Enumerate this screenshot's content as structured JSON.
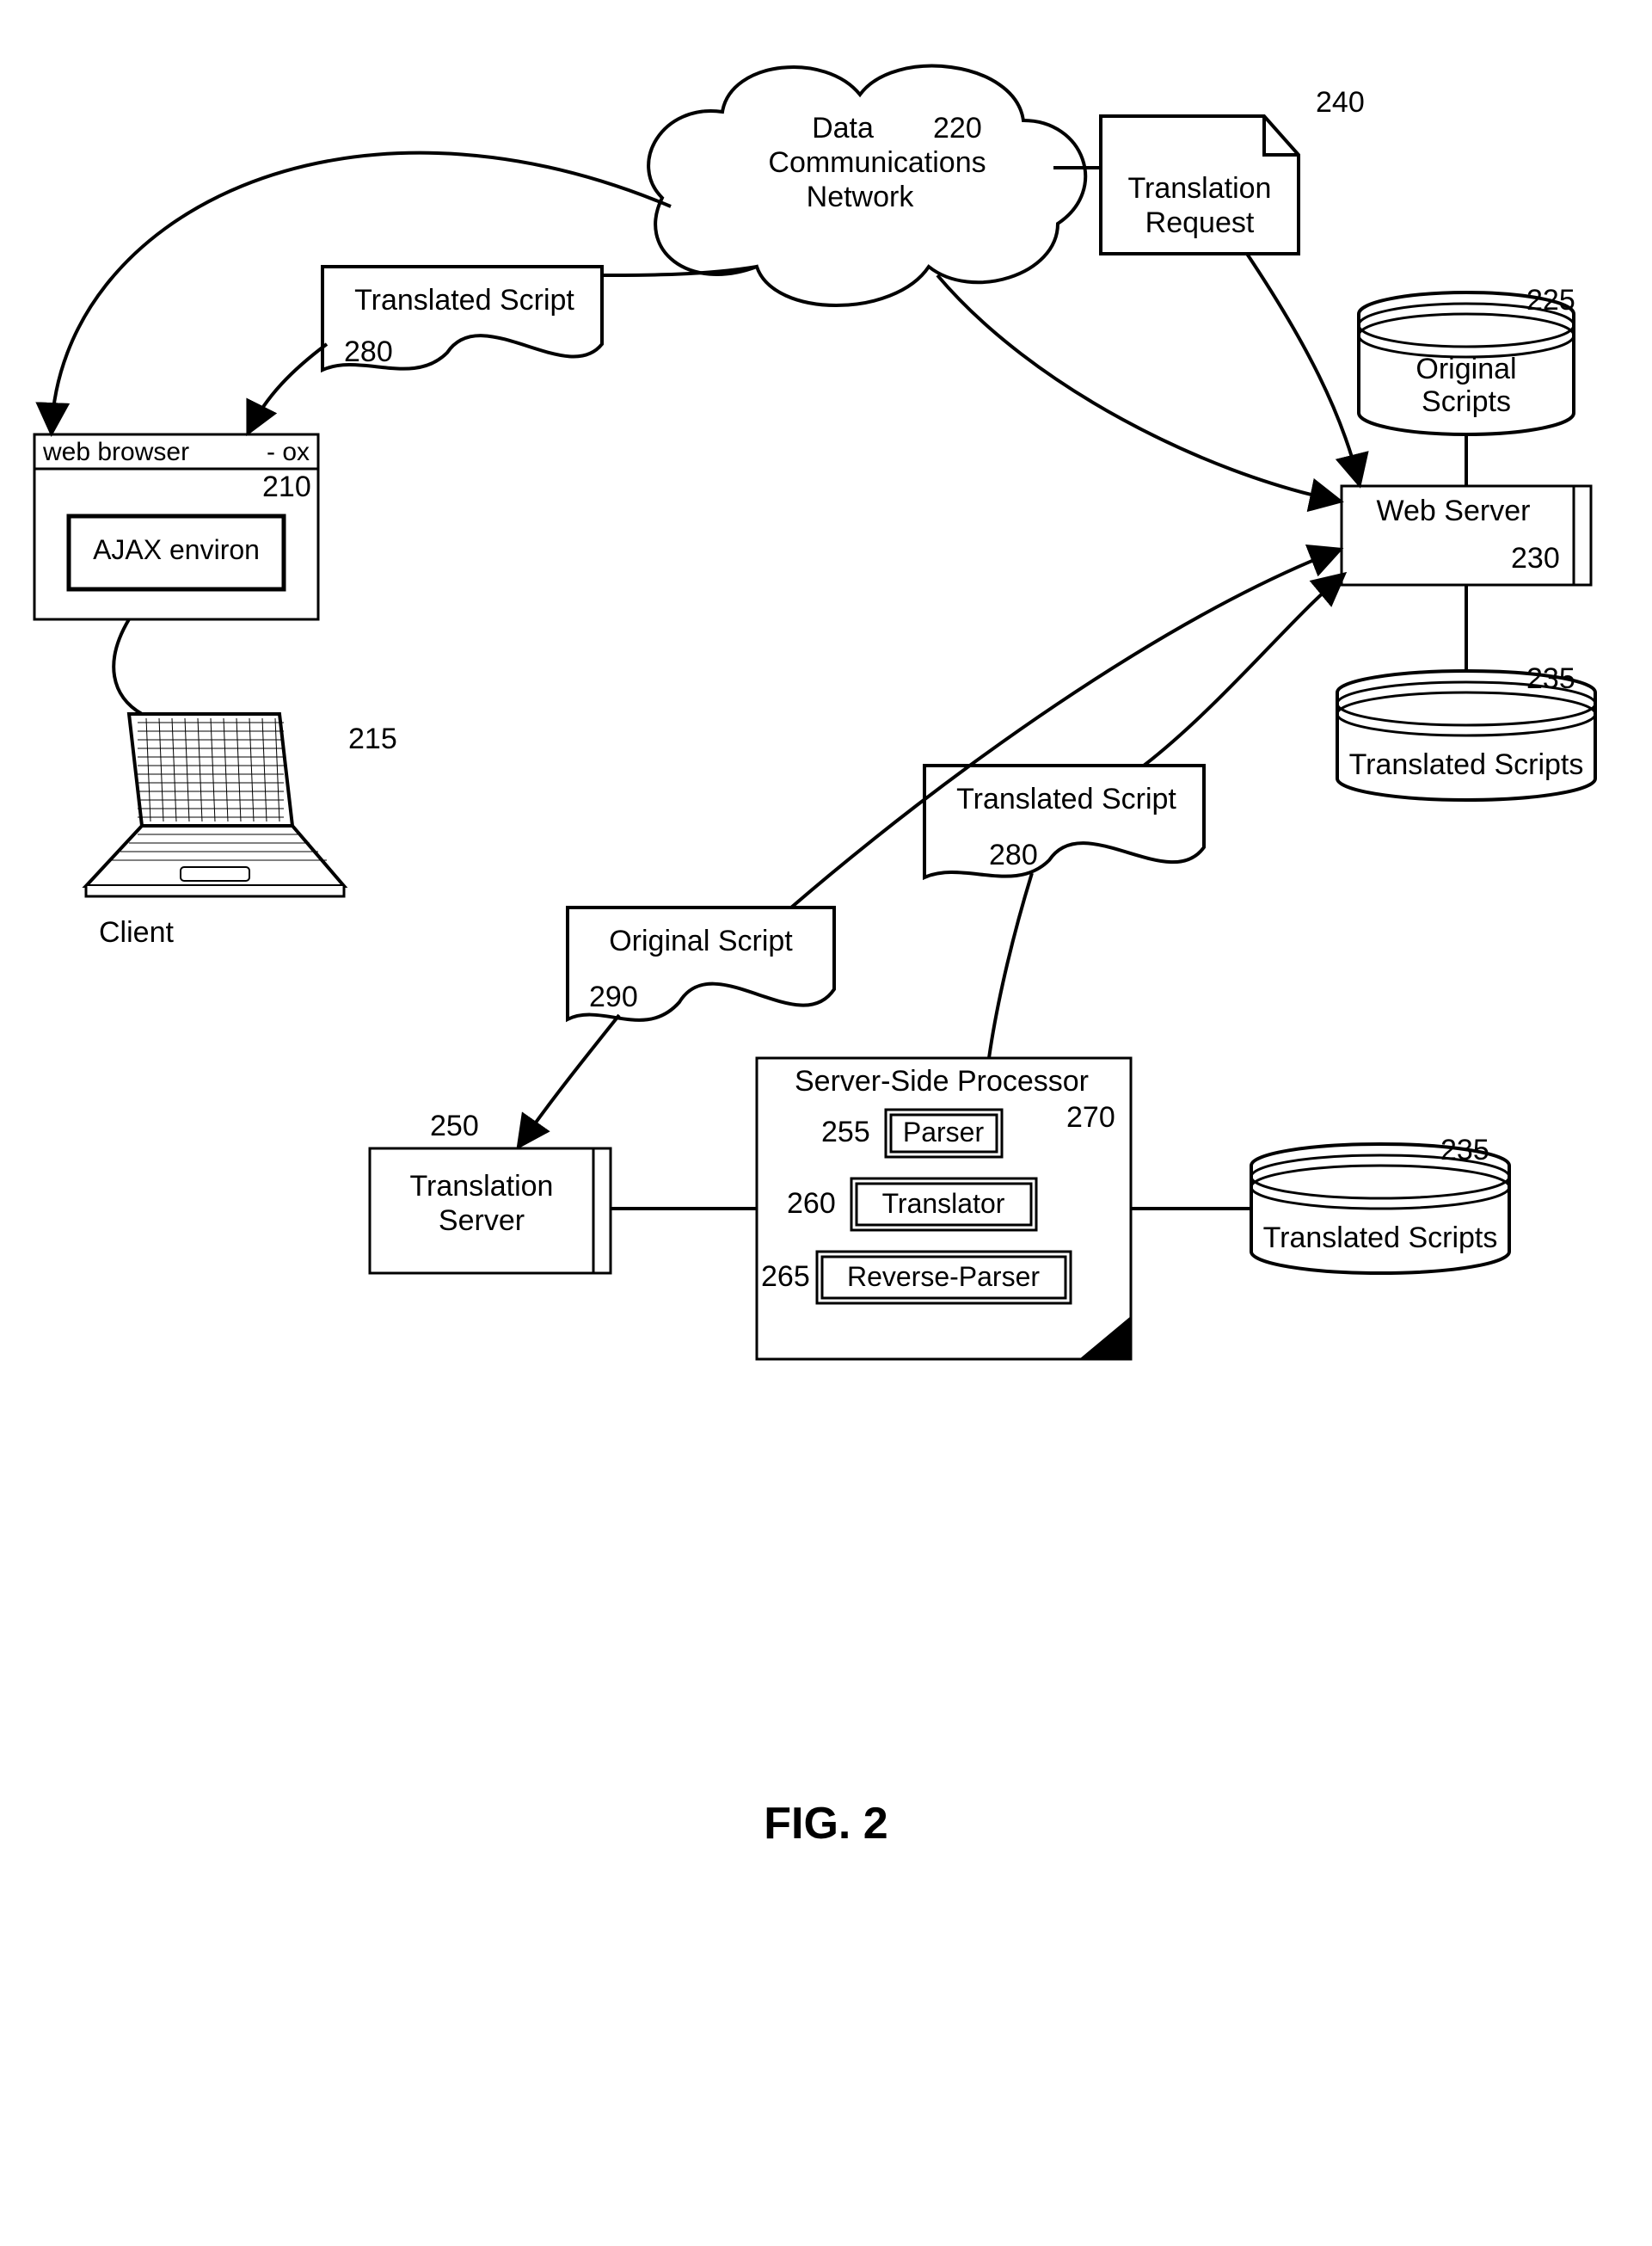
{
  "figure_caption": "FIG. 2",
  "cloud": {
    "label_line1": "Data",
    "label_line2": "Communications",
    "label_line3": "Network",
    "ref": "220"
  },
  "translation_request": {
    "label_line1": "Translation",
    "label_line2": "Request",
    "ref": "240"
  },
  "original_scripts_db": {
    "label_line1": "Original",
    "label_line2": "Scripts",
    "ref": "225"
  },
  "web_server": {
    "label": "Web Server",
    "ref": "230"
  },
  "translated_scripts_db1": {
    "label": "Translated Scripts",
    "ref": "235"
  },
  "translated_scripts_db2": {
    "label": "Translated Scripts",
    "ref": "235"
  },
  "translated_script_1": {
    "label": "Translated Script",
    "ref": "280"
  },
  "translated_script_2": {
    "label": "Translated Script",
    "ref": "280"
  },
  "original_script_doc": {
    "label": "Original  Script",
    "ref": "290"
  },
  "browser": {
    "title": "web browser",
    "win_controls": "- ox",
    "ref": "210",
    "inner_label": "AJAX environ"
  },
  "client": {
    "label": "Client",
    "ref": "215"
  },
  "translation_server": {
    "label_line1": "Translation",
    "label_line2": "Server",
    "ref": "250"
  },
  "processor": {
    "title": "Server-Side Processor",
    "ref": "270",
    "parser": {
      "label": "Parser",
      "ref": "255"
    },
    "translator": {
      "label": "Translator",
      "ref": "260"
    },
    "reverse_parser": {
      "label": "Reverse-Parser",
      "ref": "265"
    }
  }
}
